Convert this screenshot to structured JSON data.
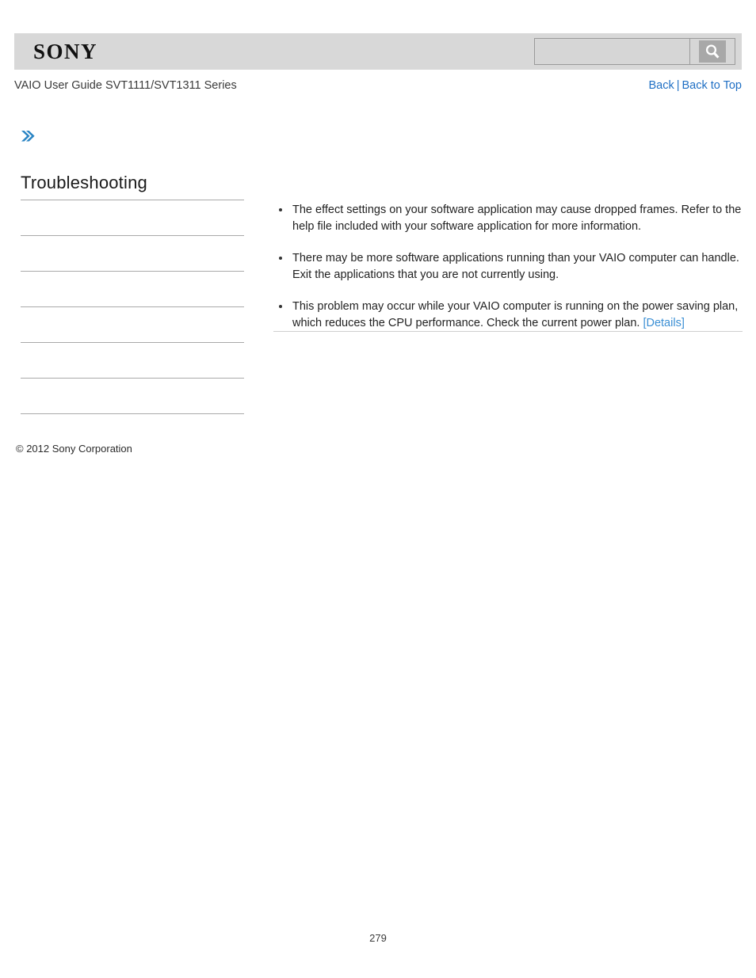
{
  "header": {
    "brand_logo_text": "SONY",
    "brand_band_color": "#d8d8d8",
    "search": {
      "value": "",
      "placeholder": "",
      "button_label": "",
      "icon": "search-icon"
    }
  },
  "subheader": {
    "guide_title": "VAIO User Guide SVT1111/SVT1311 Series",
    "links": {
      "back": "Back",
      "separator": "|",
      "back_to_top": "Back to Top"
    },
    "link_color": "#1f6fc4"
  },
  "breadcrumb": {
    "icon": "double-chevron-right-icon",
    "icon_color": "#2b85c4",
    "text": ""
  },
  "sidebar": {
    "title": "Troubleshooting",
    "items": [
      {
        "label": ""
      },
      {
        "label": ""
      },
      {
        "label": ""
      },
      {
        "label": ""
      },
      {
        "label": ""
      },
      {
        "label": ""
      }
    ]
  },
  "main": {
    "bullets": [
      {
        "text": "The effect settings on your software application may cause dropped frames. Refer to the help file included with your software application for more information.",
        "link": ""
      },
      {
        "text": "There may be more software applications running than your VAIO computer can handle. Exit the applications that you are not currently using.",
        "link": ""
      },
      {
        "text": "This problem may occur while your VAIO computer is running on the power saving plan, which reduces the CPU performance. Check the current power plan. ",
        "link": "[Details]"
      }
    ],
    "detail_link_color": "#3b8fd4"
  },
  "footer": {
    "copyright": "© 2012 Sony Corporation",
    "page_number": "279"
  }
}
